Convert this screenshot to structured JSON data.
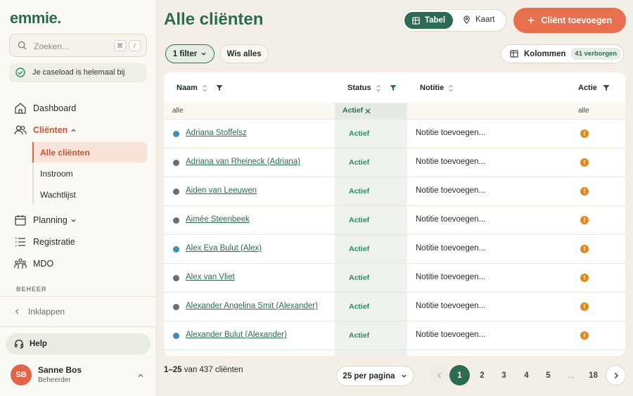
{
  "sidebar": {
    "logo": "emmie.",
    "search_placeholder": "Zoeken...",
    "shortcut_keys": [
      "⌘",
      "/"
    ],
    "caseload_status": "Je caseload is helemaal bij",
    "nav": {
      "dashboard": "Dashboard",
      "clients": "Cliënten",
      "clients_sub": [
        "Alle cliënten",
        "Instroom",
        "Wachtlijst"
      ],
      "planning": "Planning",
      "registration": "Registratie",
      "mdo": "MDO"
    },
    "section_label": "BEHEER",
    "collapse_label": "Inklappen",
    "help_label": "Help",
    "user": {
      "initials": "SB",
      "name": "Sanne Bos",
      "role": "Beheerder"
    }
  },
  "header": {
    "title": "Alle cliënten",
    "view_toggle": {
      "table": "Tabel",
      "map": "Kaart",
      "active": "Tabel"
    },
    "add_client": "Cliënt toevoegen"
  },
  "toolbar": {
    "filter_label": "1 filter",
    "clear_label": "Wis alles",
    "columns_label": "Kolommen",
    "hidden_badge": "41 verborgen"
  },
  "table": {
    "columns": {
      "name": "Naam",
      "status": "Status",
      "note": "Notitie",
      "action": "Actie"
    },
    "filters": {
      "name": "alle",
      "status": "Actief",
      "action": "alle"
    },
    "rows": [
      {
        "name": "Adriana Stoffelsz",
        "dot": "#3b8fb7",
        "status": "Actief",
        "note": "Notitie toevoegen..."
      },
      {
        "name": "Adriana van Rheineck (Adriana)",
        "dot": "#6b6f6b",
        "status": "Actief",
        "note": "Notitie toevoegen..."
      },
      {
        "name": "Aiden van Leeuwen",
        "dot": "#6b6f6b",
        "status": "Actief",
        "note": "Notitie toevoegen..."
      },
      {
        "name": "Aimée Steenbeek",
        "dot": "#6b6f6b",
        "status": "Actief",
        "note": "Notitie toevoegen..."
      },
      {
        "name": "Alex Eva Bulut (Alex)",
        "dot": "#3b8fb7",
        "status": "Actief",
        "note": "Notitie toevoegen..."
      },
      {
        "name": "Alex van Vliet",
        "dot": "#6b6f6b",
        "status": "Actief",
        "note": "Notitie toevoegen..."
      },
      {
        "name": "Alexander Angelina Smit (Alexander)",
        "dot": "#6b6f6b",
        "status": "Actief",
        "note": "Notitie toevoegen..."
      },
      {
        "name": "Alexander Bulut (Alexander)",
        "dot": "#3b8fb7",
        "status": "Actief",
        "note": "Notitie toevoegen..."
      }
    ]
  },
  "footer": {
    "range": "1–25",
    "range_suffix": "van 437 cliënten",
    "per_page": "25 per pagina",
    "pages": [
      "1",
      "2",
      "3",
      "4",
      "5",
      "...",
      "18"
    ],
    "current_page": "1"
  },
  "colors": {
    "brand": "#2d6a54",
    "accent": "#e8704f",
    "warning": "#e08a1e"
  }
}
